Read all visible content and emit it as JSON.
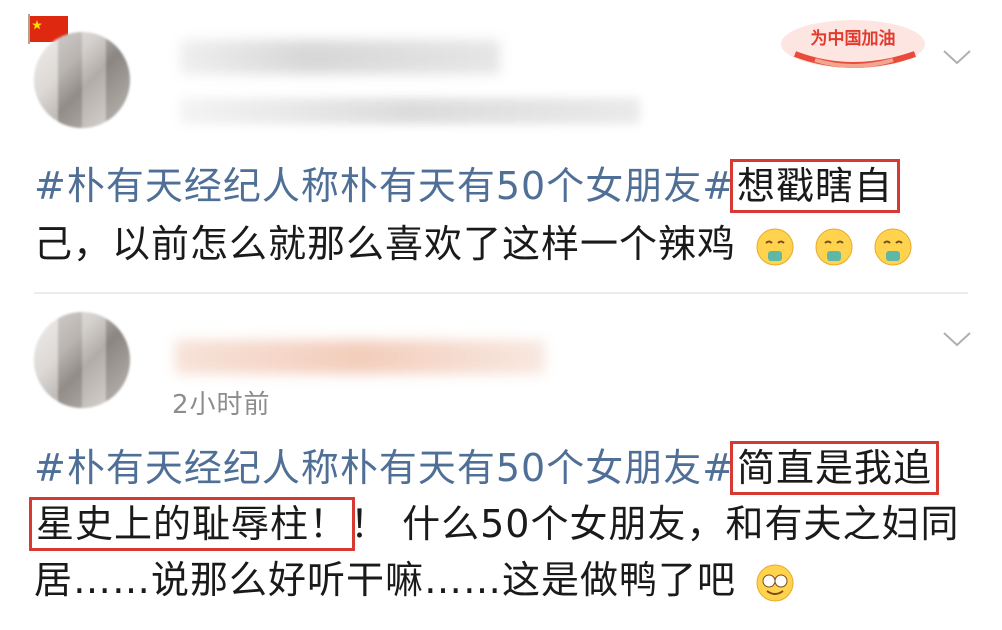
{
  "post1": {
    "badge_text": "为中国加油",
    "content_topic": "#朴有天经纪人称朴有天有50个女朋友#",
    "content_boxed": "想戳瞎自",
    "content_line2": "己，以前怎么就那么喜欢了这样一个辣鸡",
    "emojis": [
      "vomit-emoji",
      "vomit-emoji",
      "vomit-emoji"
    ]
  },
  "post2": {
    "time": "2小时前",
    "content_topic": "#朴有天经纪人称朴有天有50个女朋友#",
    "content_boxed1": "简直是我追",
    "content_boxed2": "星史上的耻辱柱！",
    "content_line2_rest": "！ 什么50个女朋友，和有夫之妇同",
    "content_line3": "居……说那么好听干嘛……这是做鸭了吧",
    "emoji": "laugh-cry-emoji"
  },
  "colors": {
    "topic": "#4f6f96",
    "highlight_box": "#d63a33",
    "meta": "#8d8d8d"
  }
}
